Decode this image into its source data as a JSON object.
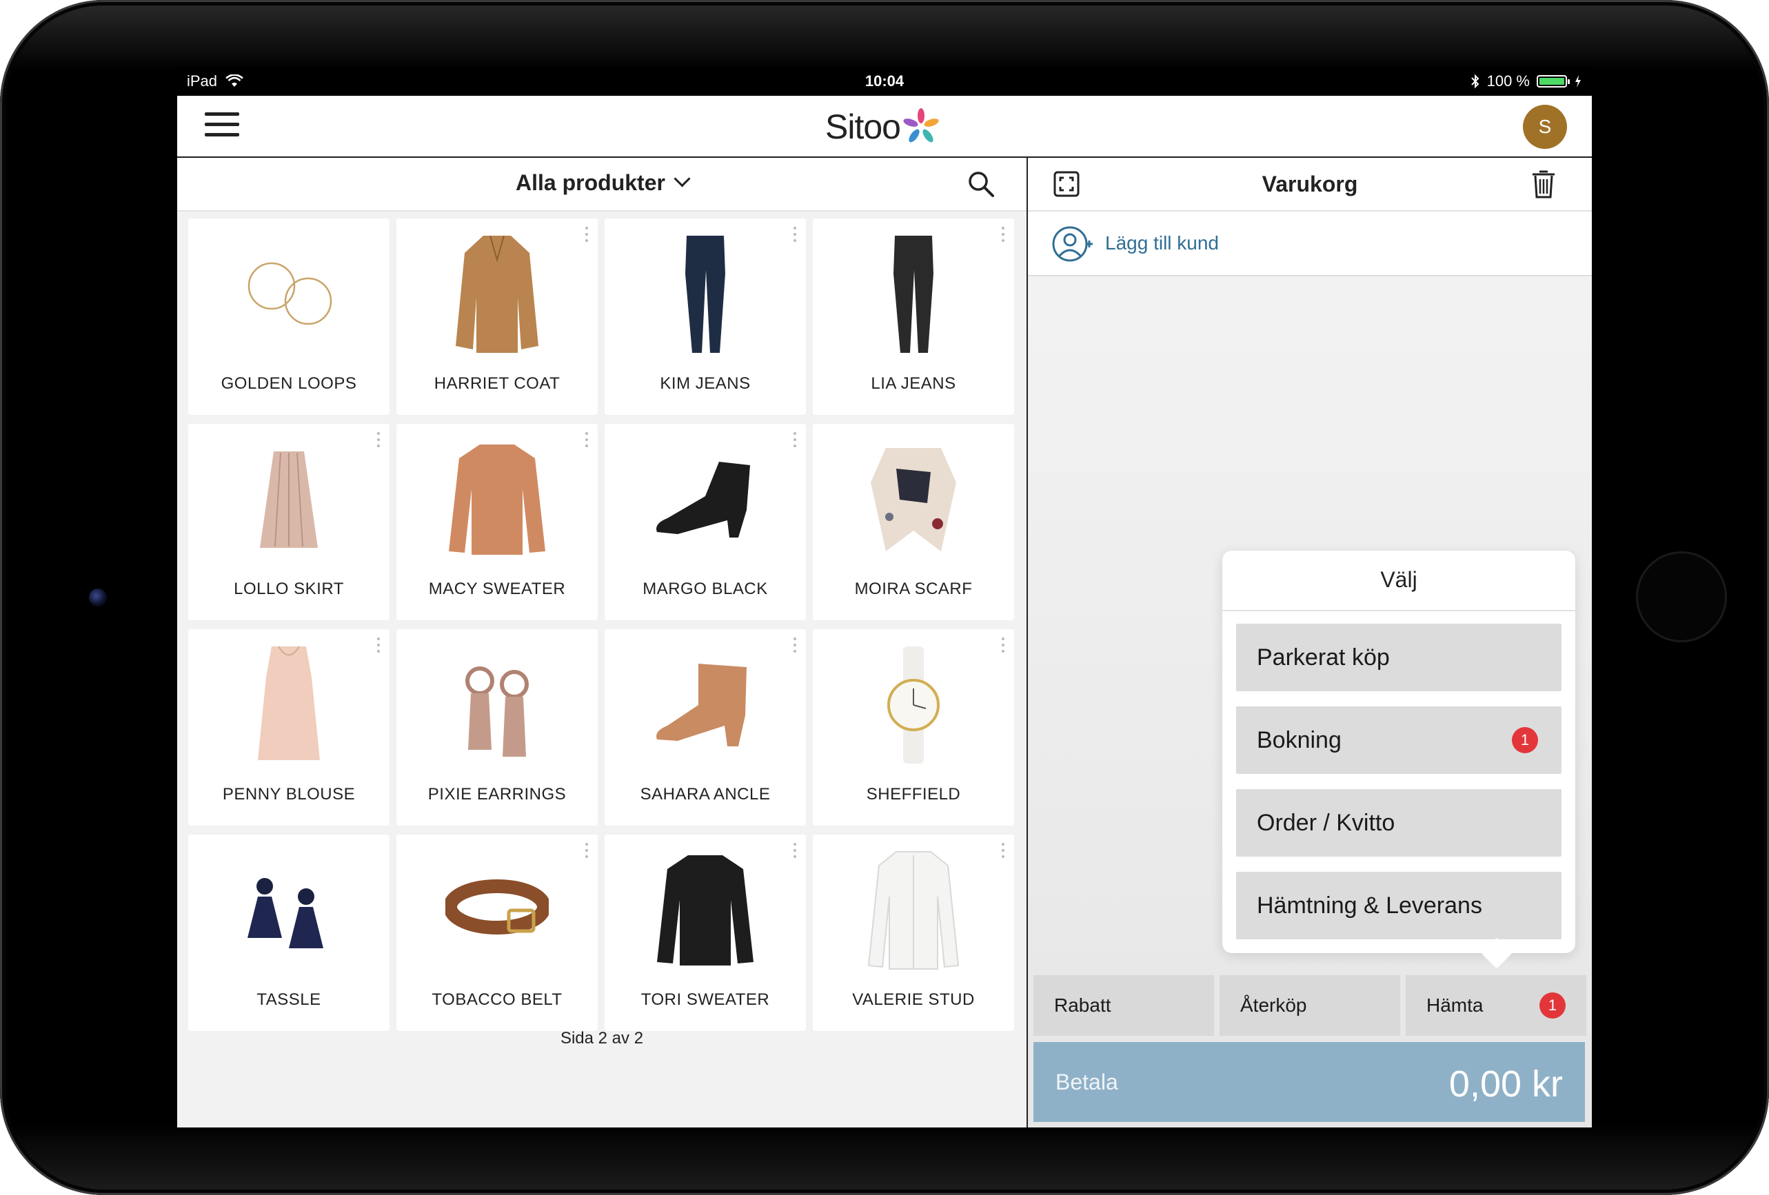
{
  "statusbar": {
    "device": "iPad",
    "time": "10:04",
    "battery": "100 %"
  },
  "navbar": {
    "logo": "Sitoo",
    "avatar_initial": "S"
  },
  "products": {
    "category": "Alla produkter",
    "items": [
      {
        "name": "GOLDEN LOOPS"
      },
      {
        "name": "HARRIET COAT"
      },
      {
        "name": "KIM JEANS"
      },
      {
        "name": "LIA JEANS"
      },
      {
        "name": "LOLLO SKIRT"
      },
      {
        "name": "MACY SWEATER"
      },
      {
        "name": "MARGO BLACK"
      },
      {
        "name": "MOIRA SCARF"
      },
      {
        "name": "PENNY BLOUSE"
      },
      {
        "name": "PIXIE EARRINGS"
      },
      {
        "name": "SAHARA ANCLE"
      },
      {
        "name": "SHEFFIELD"
      },
      {
        "name": "TASSLE"
      },
      {
        "name": "TOBACCO BELT"
      },
      {
        "name": "TORI SWEATER"
      },
      {
        "name": "VALERIE STUD"
      }
    ],
    "pager": "Sida 2 av 2"
  },
  "cart": {
    "title": "Varukorg",
    "add_customer": "Lägg till kund",
    "popover": {
      "title": "Välj",
      "items": [
        {
          "label": "Parkerat köp",
          "badge": ""
        },
        {
          "label": "Bokning",
          "badge": "1"
        },
        {
          "label": "Order / Kvitto",
          "badge": ""
        },
        {
          "label": "Hämtning & Leverans",
          "badge": ""
        }
      ]
    },
    "actions": [
      {
        "label": "Rabatt",
        "badge": ""
      },
      {
        "label": "Återköp",
        "badge": ""
      },
      {
        "label": "Hämta",
        "badge": "1"
      }
    ],
    "pay_label": "Betala",
    "total": "0,00 kr"
  },
  "colors": {
    "accent": "#2f6e94",
    "pay": "#8fb1c7",
    "badge": "#e3363a",
    "avatar": "#a07228"
  }
}
